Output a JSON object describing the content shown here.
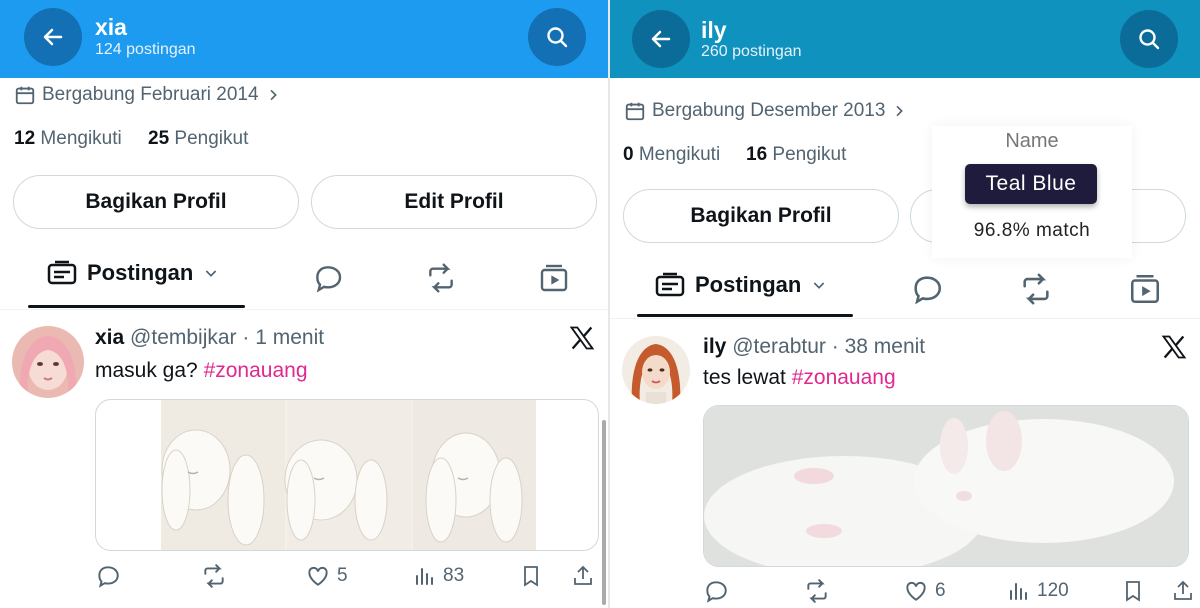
{
  "left": {
    "header": {
      "name": "xia",
      "posts": "124 postingan"
    },
    "joined": "Bergabung Februari 2014",
    "following_count": "12",
    "following_label": "Mengikuti",
    "followers_count": "25",
    "followers_label": "Pengikut",
    "buttons": {
      "share": "Bagikan Profil",
      "edit": "Edit Profil"
    },
    "tab_label": "Postingan",
    "post": {
      "name": "xia",
      "handle": "@tembijkar",
      "time": "· 1 menit",
      "text": "masuk ga?",
      "hashtag": "#zonauang",
      "likes": "5",
      "views": "83"
    }
  },
  "right": {
    "header": {
      "name": "ily",
      "posts": "260 postingan"
    },
    "joined": "Bergabung Desember 2013",
    "following_count": "0",
    "following_label": "Mengikuti",
    "followers_count": "16",
    "followers_label": "Pengikut",
    "buttons": {
      "share": "Bagikan Profil"
    },
    "tab_label": "Postingan",
    "post": {
      "name": "ily",
      "handle": "@terabtur",
      "time": "· 38 menit",
      "text": "tes lewat",
      "hashtag": "#zonauang",
      "likes": "6",
      "views": "120"
    }
  },
  "color_popup": {
    "label": "Name",
    "color_name": "Teal Blue",
    "match": "96.8% match"
  },
  "colors": {
    "left_header": "#1d9bf0",
    "right_header": "#0f92bd",
    "hashtag": "#e0288f"
  },
  "icons": [
    "back-arrow-icon",
    "search-icon",
    "calendar-icon",
    "chevron-right-icon",
    "posts-icon",
    "chevron-down-icon",
    "reply-icon",
    "repost-icon",
    "media-icon",
    "x-logo-icon",
    "like-icon",
    "views-icon",
    "bookmark-icon",
    "share-icon"
  ]
}
